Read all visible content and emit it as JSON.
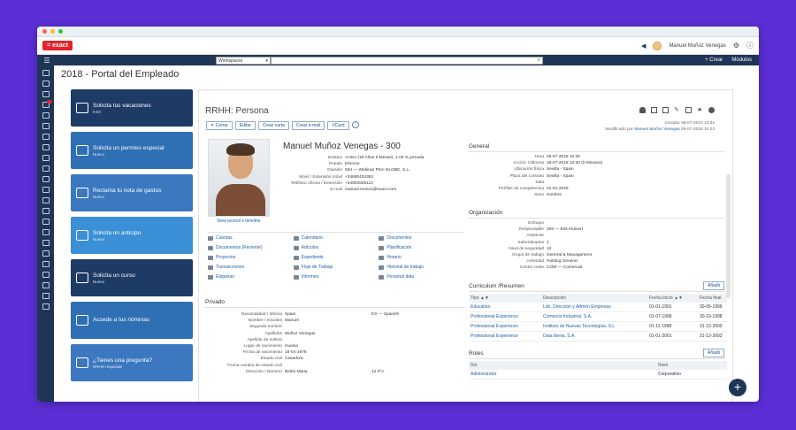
{
  "window": {
    "logo": "= exact",
    "user_name": "Manuel Muñoz Venegas"
  },
  "navbar": {
    "workspace": "Workspaces",
    "create": "+  Crear",
    "modules": "Módulos"
  },
  "page_title": "2018 - Portal del Empleado",
  "tiles": [
    {
      "label": "Solicita tus vacaciones",
      "sub": "9.63",
      "icon": "palm-tree-icon",
      "style": "t-dark"
    },
    {
      "label": "Solicita un permiso especial",
      "sub": "Nuevo",
      "icon": "clock-person-icon",
      "style": "t-blue"
    },
    {
      "label": "Reclama tu nota de gastos",
      "sub": "Nuevo",
      "icon": "receipt-icon",
      "style": "t-mid"
    },
    {
      "label": "Solicita un anticipo",
      "sub": "Nuevo",
      "icon": "money-icon",
      "style": "t-lb"
    },
    {
      "label": "Solicita un curso",
      "sub": "Nuevo",
      "icon": "graduation-cap-icon",
      "style": "t-dark"
    },
    {
      "label": "Accede a tus nóminas",
      "sub": "",
      "icon": "payslip-icon",
      "style": "t-blue"
    },
    {
      "label": "¿Tienes una pregunta?",
      "sub": "RRHH responde",
      "icon": "question-icon",
      "style": "t-mid"
    }
  ],
  "panel": {
    "title": "RRHH: Persona",
    "actions": [
      "✕ Cerrar",
      "Editar",
      "Crear carta",
      "Crear e-mail",
      "VCard"
    ],
    "creator_label": "Creador",
    "creator_date": "05-07-2010 13:32",
    "modified_label": "Modificado por",
    "modified_by": "Manuel Muñoz Venegas",
    "modified_date": "26-07-2018 10:23"
  },
  "person": {
    "name": "Manuel Muñoz Venegas - 300",
    "view_timeline": "View person's timeline",
    "fields": [
      {
        "k": "Estatus",
        "v": "Activo (18 Años 6 Meses), 1.00 % jornada"
      },
      {
        "k": "Puesto",
        "v": "Director"
      },
      {
        "k": "División",
        "v": "934 — Webinar PSA-GLOBE, S.L."
      },
      {
        "k": "Móvil / Extensión móvil",
        "v": "+34680434382"
      },
      {
        "k": "Teléfono oficina / Extensión",
        "v": "+34902506114"
      },
      {
        "k": "E-mail",
        "v": "manuel.munoz@exact.com"
      }
    ]
  },
  "links": [
    "Cuentas",
    "Calendario",
    "Documentos",
    "Documentos (Reciente)",
    "Artículos",
    "Planificación",
    "Proyectos",
    "Expediente",
    "Horario",
    "Transacciones",
    "Flujo de Trabajo",
    "Historial de trabajo",
    "Etiquetas",
    "Informes",
    "Personal data"
  ],
  "privado": {
    "title": "Privado",
    "fields": [
      {
        "k": "Nacionalidad / Idioma",
        "v": "Spain"
      },
      {
        "k": "Nombre / Iniciales",
        "v": "Manuel"
      },
      {
        "k": "Segundo nombre",
        "v": ""
      },
      {
        "k": "Apellidos",
        "v": "Muñoz Venegas"
      },
      {
        "k": "Apellido de soltera",
        "v": ""
      },
      {
        "k": "Lugar de nacimiento",
        "v": "Huelva"
      },
      {
        "k": "Fecha de nacimiento",
        "v": "16-04-1978"
      },
      {
        "k": "Estado civil",
        "v": "Casado/a"
      },
      {
        "k": "Fecha cambio de estado civil",
        "v": ""
      },
      {
        "k": "Dirección / Número",
        "v": "Belén Maria"
      }
    ],
    "language": "ES — Spanish",
    "house_number": "12 3ºA"
  },
  "general": {
    "title": "General",
    "fields": [
      {
        "k": "Hora",
        "v": "26-07-2018 10:30"
      },
      {
        "k": "Acción: Ultimora",
        "v": "26-07-2018 10:30 (0 Minutos)"
      },
      {
        "k": "Ubicación física",
        "v": "Sevilla - Spain"
      },
      {
        "k": "Plaza del contrato",
        "v": "Sevilla - Spain"
      },
      {
        "k": "Sala",
        "v": ""
      },
      {
        "k": "Perfiles de competencia",
        "v": "01-01-2018"
      },
      {
        "k": "Sexo",
        "v": "Hombre"
      }
    ]
  },
  "organizacion": {
    "title": "Organización",
    "fields": [
      {
        "k": "Enfoque",
        "v": ""
      },
      {
        "k": "Responsable",
        "v": "306 — Erik Kluivert"
      },
      {
        "k": "Asistente",
        "v": ""
      },
      {
        "k": "Subordinados",
        "v": "2"
      },
      {
        "k": "Nivel de seguridad",
        "v": "10"
      },
      {
        "k": "Grupo de trabajo",
        "v": "General & Management"
      },
      {
        "k": "Actividad",
        "v": "Holding General"
      },
      {
        "k": "Centro coste",
        "v": "COM — Comercial"
      }
    ]
  },
  "curriculum": {
    "title": "Curriculum /Resumen",
    "add": "Añadir",
    "headers": [
      "Tipo ▲▼",
      "Descripción",
      "Fecha inicio ▲▼",
      "Fecha final"
    ],
    "rows": [
      [
        "Education",
        "Ldo. Dirección y Admón Empresas",
        "01-01-1991",
        "30-06-1996"
      ],
      [
        "Professional Experience",
        "Comercio Industrial, S.A.",
        "01-07-1996",
        "30-10-1998"
      ],
      [
        "Professional Experience",
        "Instituto de Nuevas Tecnologías, S.L.",
        "01-11-1998",
        "31-12-2000"
      ],
      [
        "Professional Experience",
        "Data Iberia, S.A.",
        "01-01-2001",
        "31-12-2003"
      ]
    ]
  },
  "roles": {
    "title": "Roles",
    "add": "Añadir",
    "headers": [
      "Rol",
      "Nivel"
    ],
    "rows": [
      [
        "Administrator",
        "Corporativo"
      ]
    ]
  },
  "fab": "+"
}
